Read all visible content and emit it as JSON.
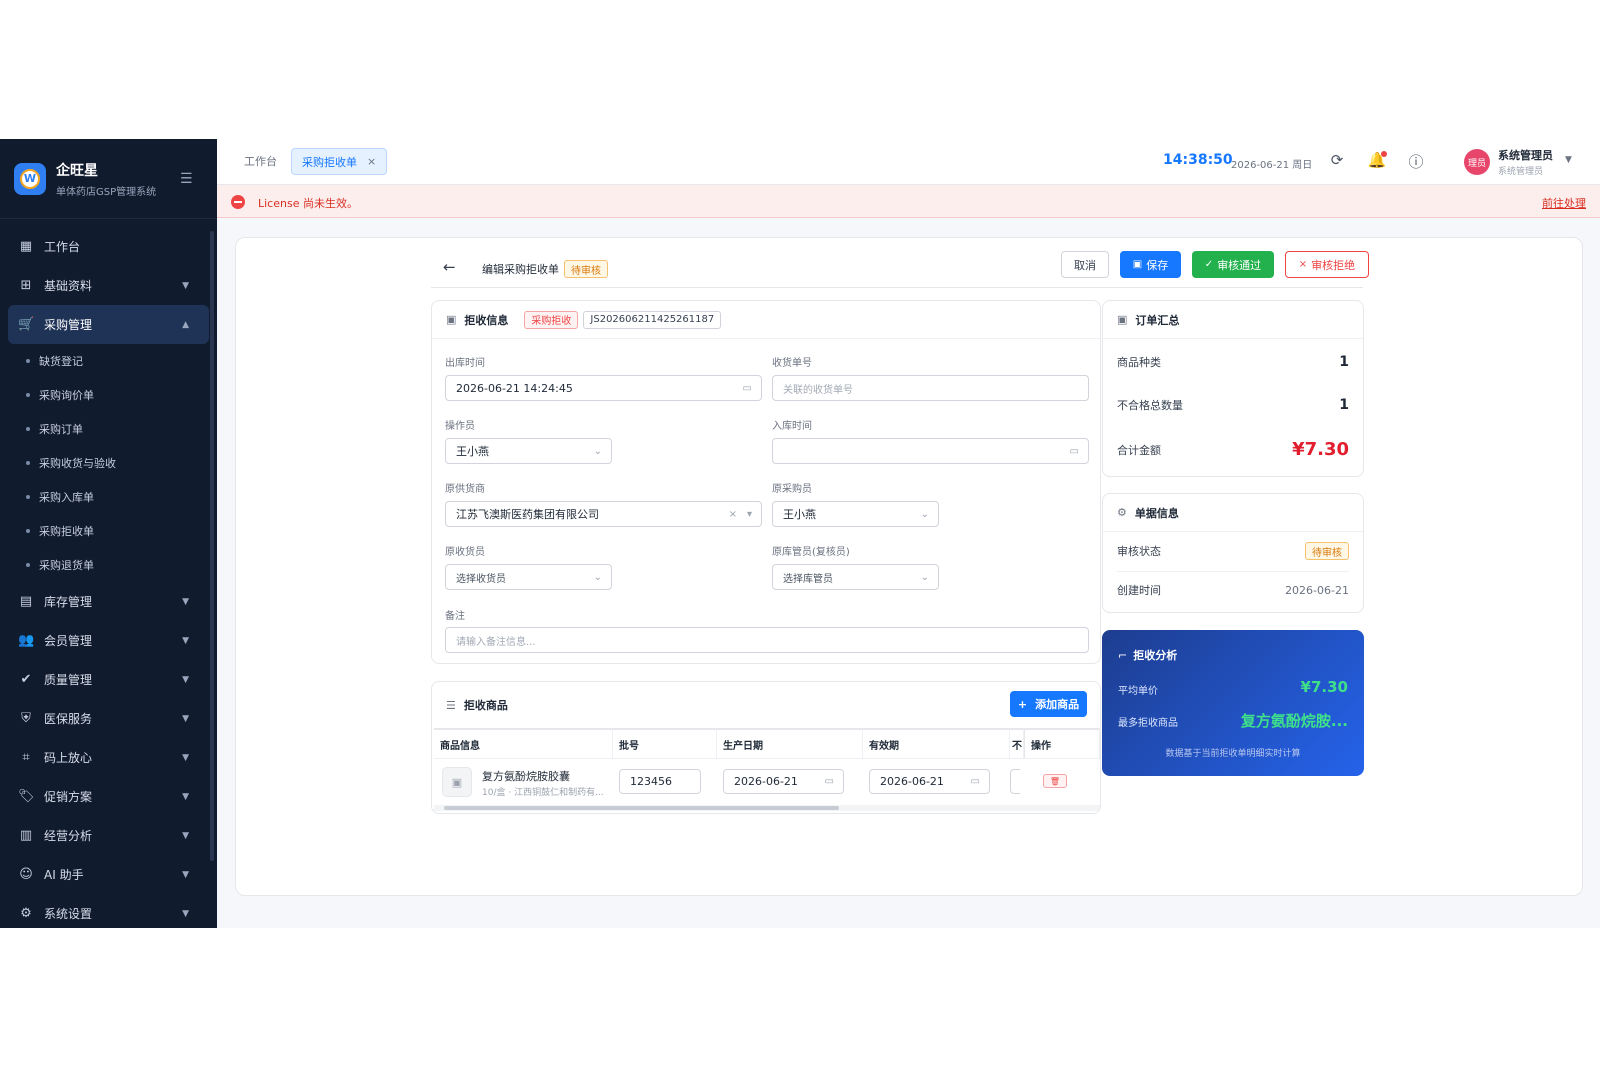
{
  "sidebar": {
    "brand_title": "企旺星",
    "brand_sub": "单体药店GSP管理系统",
    "items": [
      {
        "label": "工作台",
        "icon": "▦"
      },
      {
        "label": "基础资料",
        "icon": "⊞"
      },
      {
        "label": "采购管理",
        "icon": "🛒"
      },
      {
        "label": "库存管理",
        "icon": "▤"
      },
      {
        "label": "会员管理",
        "icon": "👥"
      },
      {
        "label": "质量管理",
        "icon": "✔"
      },
      {
        "label": "医保服务",
        "icon": "⛨"
      },
      {
        "label": "码上放心",
        "icon": "⌗"
      },
      {
        "label": "促销方案",
        "icon": "🏷"
      },
      {
        "label": "经营分析",
        "icon": "▥"
      },
      {
        "label": "AI 助手",
        "icon": "☺"
      },
      {
        "label": "系统设置",
        "icon": "⚙"
      }
    ],
    "sub_items": [
      "缺货登记",
      "采购询价单",
      "采购订单",
      "采购收货与验收",
      "采购入库单",
      "采购拒收单",
      "采购退货单"
    ]
  },
  "topbar": {
    "tab_home": "工作台",
    "tab_active": "采购拒收单",
    "time": "14:38:50",
    "date": "2026-06-21 周日",
    "avatar_text": "理员",
    "user_name": "系统管理员",
    "user_role": "系统管理员"
  },
  "license": {
    "message": "License 尚未生效。",
    "link": "前往处理"
  },
  "page": {
    "title": "编辑采购拒收单",
    "status": "待审核",
    "btn_cancel": "取消",
    "btn_save": "保存",
    "btn_approve": "审核通过",
    "btn_reject": "审核拒绝"
  },
  "reject_info": {
    "title": "拒收信息",
    "tag": "采购拒收",
    "order_no": "JS202606211425261187",
    "out_time_label": "出库时间",
    "out_time": "2026-06-21 14:24:45",
    "receipt_no_label": "收货单号",
    "receipt_no_placeholder": "关联的收货单号",
    "operator_label": "操作员",
    "operator": "王小燕",
    "in_time_label": "入库时间",
    "supplier_label": "原供货商",
    "supplier": "江苏飞澳斯医药集团有限公司",
    "buyer_label": "原采购员",
    "buyer": "王小燕",
    "receiver_label": "原收货员",
    "receiver_placeholder": "选择收货员",
    "keeper_label": "原库管员(复核员)",
    "keeper_placeholder": "选择库管员",
    "remark_label": "备注",
    "remark_placeholder": "请输入备注信息..."
  },
  "goods": {
    "title": "拒收商品",
    "add_btn": "添加商品",
    "columns": [
      "商品信息",
      "批号",
      "生产日期",
      "有效期",
      "不",
      "操作"
    ],
    "rows": [
      {
        "name": "复方氨酚烷胺胶囊",
        "sub": "10/盒 · 江西铜鼓仁和制药有...",
        "batch": "123456",
        "prod_date": "2026-06-21",
        "expiry": "2026-06-21"
      }
    ]
  },
  "summary": {
    "title": "订单汇总",
    "kinds_label": "商品种类",
    "kinds": "1",
    "qty_label": "不合格总数量",
    "qty": "1",
    "total_label": "合计金额",
    "total": "¥7.30"
  },
  "doc_info": {
    "title": "单据信息",
    "status_label": "审核状态",
    "status": "待审核",
    "created_label": "创建时间",
    "created": "2026-06-21"
  },
  "analysis": {
    "title": "拒收分析",
    "avg_label": "平均单价",
    "avg": "¥7.30",
    "top_label": "最多拒收商品",
    "top": "复方氨酚烷胺...",
    "note": "数据基于当前拒收单明细实时计算"
  },
  "colors": {
    "accent": "#1677ff",
    "sidebar": "#111b2e",
    "approve": "#22b14c",
    "danger": "#ef4444"
  }
}
